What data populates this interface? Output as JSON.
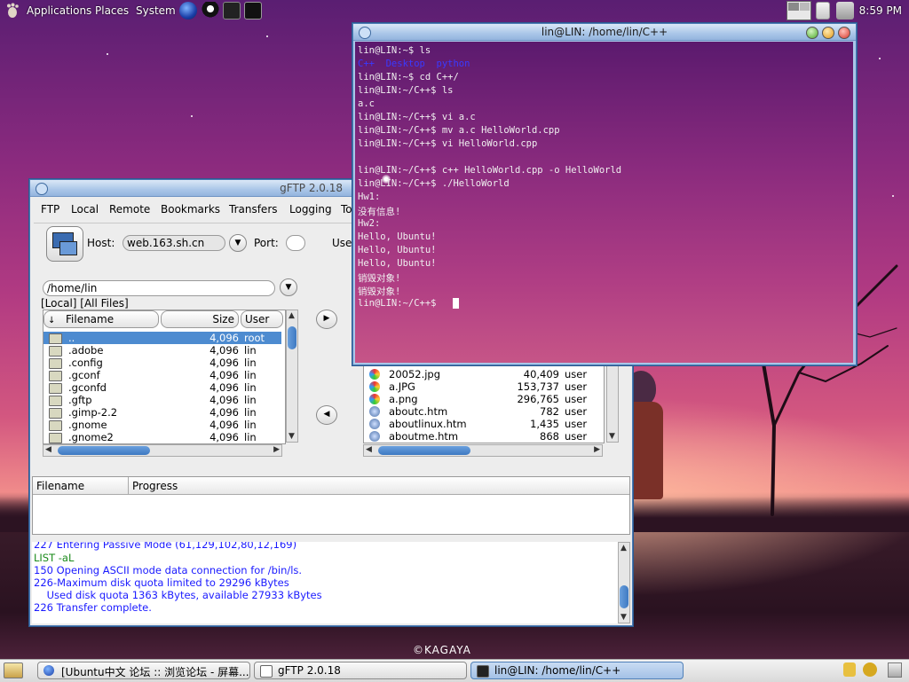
{
  "top_panel": {
    "menus": [
      "Applications",
      "Places",
      "System"
    ],
    "clock": "8:59 PM"
  },
  "terminal": {
    "title": "lin@LIN: /home/lin/C++",
    "lines": [
      "lin@LIN:~$ ls",
      "C++  Desktop  python",
      "lin@LIN:~$ cd C++/",
      "lin@LIN:~/C++$ ls",
      "a.c",
      "lin@LIN:~/C++$ vi a.c",
      "lin@LIN:~/C++$ mv a.c HelloWorld.cpp",
      "lin@LIN:~/C++$ vi HelloWorld.cpp",
      "",
      "lin@LIN:~/C++$ c++ HelloWorld.cpp -o HelloWorld",
      "lin@LIN:~/C++$ ./HelloWorld",
      "Hw1:",
      "没有信息!",
      "Hw2:",
      "Hello, Ubuntu!",
      "Hello, Ubuntu!",
      "Hello, Ubuntu!",
      "销毁对象!",
      "销毁对象!",
      "lin@LIN:~/C++$ "
    ]
  },
  "gftp": {
    "title": "gFTP 2.0.18",
    "menu": [
      "FTP",
      "Local",
      "Remote",
      "Bookmarks",
      "Transfers",
      "Logging",
      "To"
    ],
    "host_label": "Host:",
    "host_value": "web.163.sh.cn",
    "port_label": "Port:",
    "user_label": "Use",
    "local_path": "/home/lin",
    "local_caption": "[Local] [All Files]",
    "columns": {
      "filename": "Filename",
      "size": "Size",
      "user": "User"
    },
    "local_files": [
      {
        "name": "..",
        "size": "4,096",
        "user": "root"
      },
      {
        "name": ".adobe",
        "size": "4,096",
        "user": "lin"
      },
      {
        "name": ".config",
        "size": "4,096",
        "user": "lin"
      },
      {
        "name": ".gconf",
        "size": "4,096",
        "user": "lin"
      },
      {
        "name": ".gconfd",
        "size": "4,096",
        "user": "lin"
      },
      {
        "name": ".gftp",
        "size": "4,096",
        "user": "lin"
      },
      {
        "name": ".gimp-2.2",
        "size": "4,096",
        "user": "lin"
      },
      {
        "name": ".gnome",
        "size": "4,096",
        "user": "lin"
      },
      {
        "name": ".gnome2",
        "size": "4,096",
        "user": "lin"
      }
    ],
    "remote_files": [
      {
        "name": "20052.jpg",
        "size": "40,409",
        "user": "user"
      },
      {
        "name": "a.JPG",
        "size": "153,737",
        "user": "user"
      },
      {
        "name": "a.png",
        "size": "296,765",
        "user": "user"
      },
      {
        "name": "aboutc.htm",
        "size": "782",
        "user": "user"
      },
      {
        "name": "aboutlinux.htm",
        "size": "1,435",
        "user": "user"
      },
      {
        "name": "aboutme.htm",
        "size": "868",
        "user": "user"
      }
    ],
    "transfer_columns": {
      "filename": "Filename",
      "progress": "Progress"
    },
    "log": [
      "227 Entering Passive Mode (61,129,102,80,12,169)",
      "LIST -aL",
      "150 Opening ASCII mode data connection for /bin/ls.",
      "226-Maximum disk quota limited to 29296 kBytes",
      "    Used disk quota 1363 kBytes, available 27933 kBytes",
      "226 Transfer complete."
    ]
  },
  "taskbar": {
    "tasks": [
      {
        "label": "[Ubuntu中文 论坛 :: 浏览论坛 - 屏幕..."
      },
      {
        "label": "gFTP 2.0.18"
      },
      {
        "label": "lin@LIN: /home/lin/C++"
      }
    ]
  },
  "watermark": "©KAGAYA"
}
